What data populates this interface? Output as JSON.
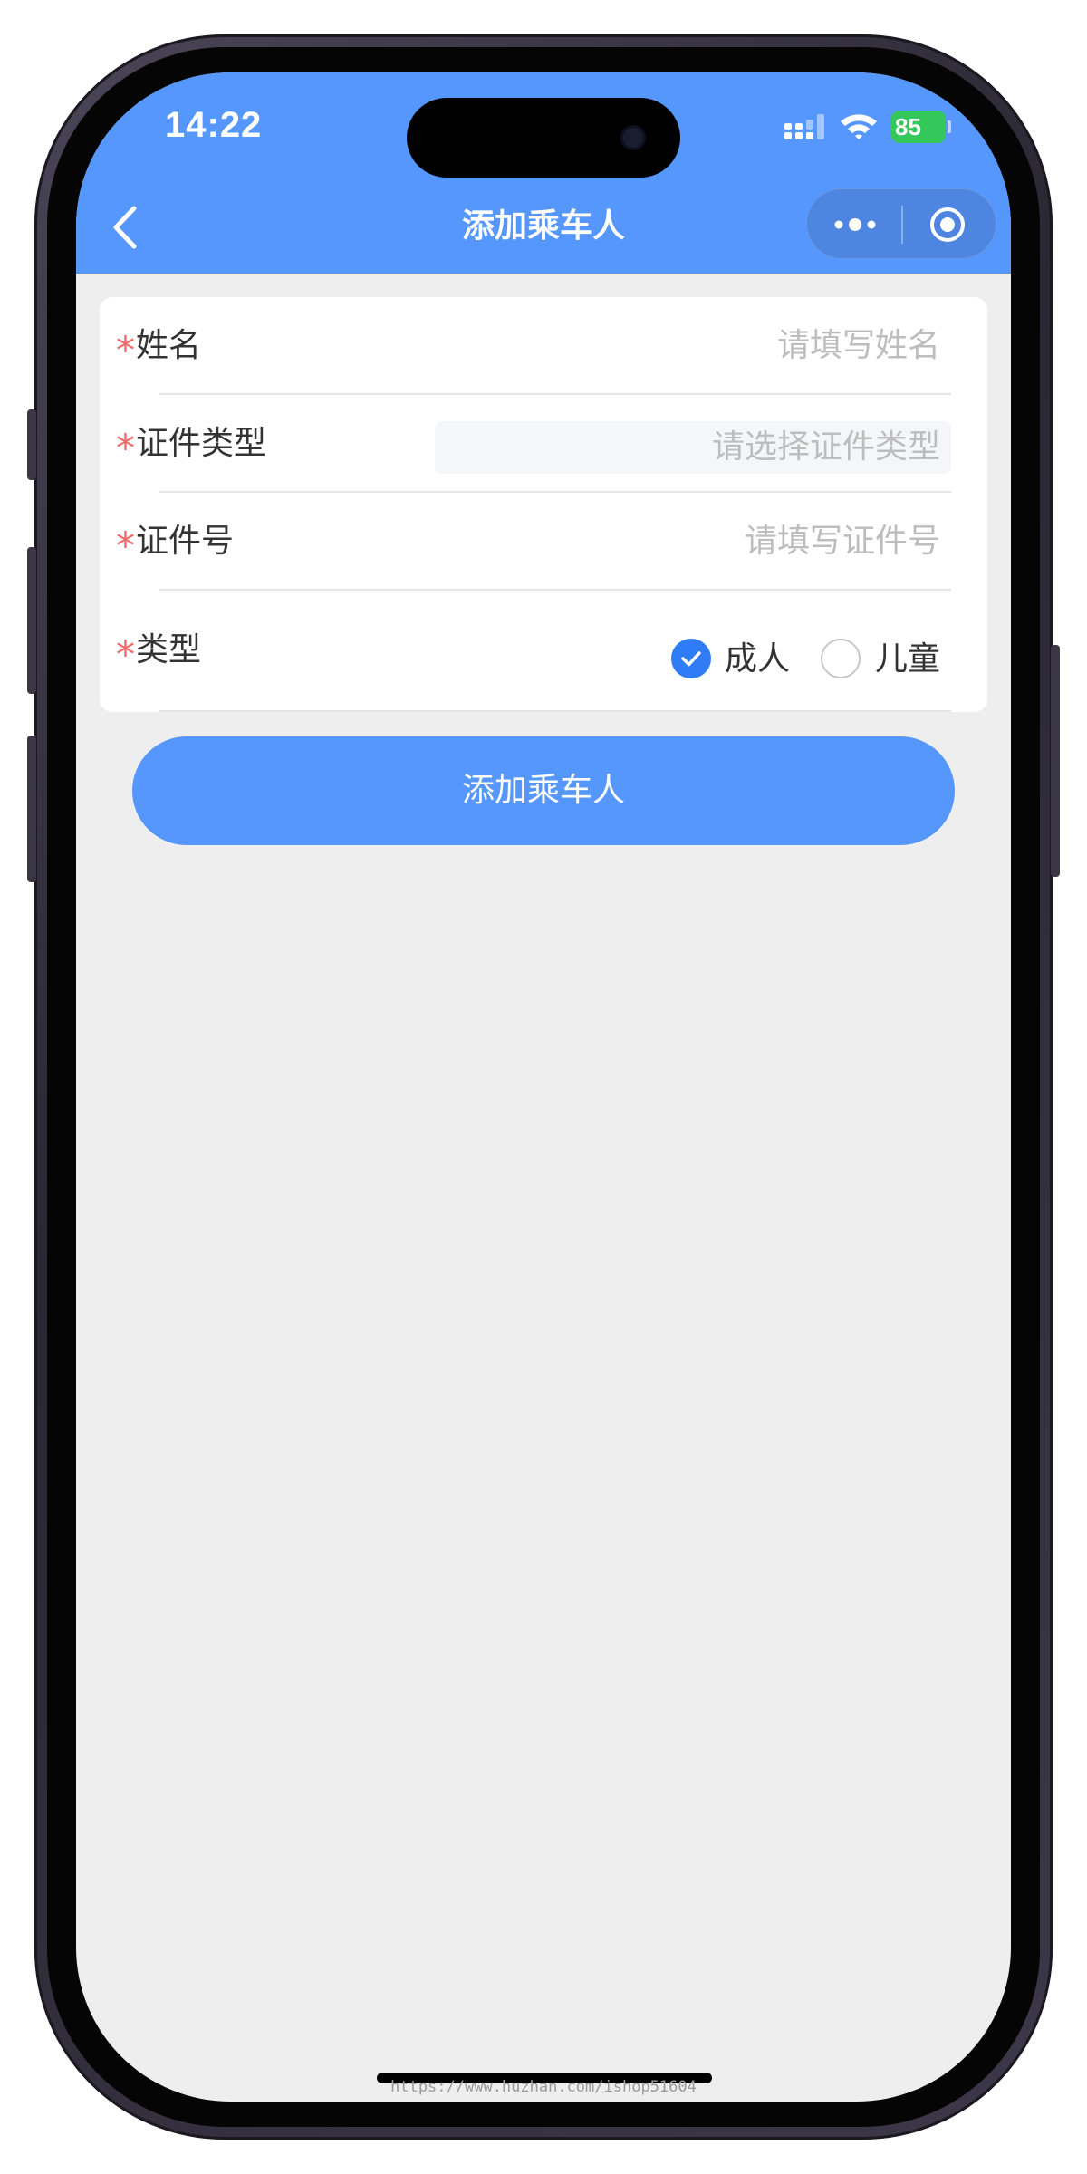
{
  "status_bar": {
    "time": "14:22",
    "battery_level": "85",
    "signal_icon": "cellular-signal-icon",
    "wifi_icon": "wifi-icon",
    "battery_color": "#34c759"
  },
  "nav_bar": {
    "title": "添加乘车人",
    "back_icon": "chevron-left-icon",
    "menu_icon": "more-dots-icon",
    "close_icon": "target-circle-icon",
    "background_color": "#5597fc"
  },
  "form": {
    "required_mark": "*",
    "name_field": {
      "label": "姓名",
      "placeholder": "请填写姓名"
    },
    "id_type_field": {
      "label": "证件类型",
      "placeholder": "请选择证件类型"
    },
    "id_number_field": {
      "label": "证件号",
      "placeholder": "请填写证件号"
    },
    "type_field": {
      "label": "类型",
      "options": [
        {
          "label": "成人",
          "checked": true
        },
        {
          "label": "儿童",
          "checked": false
        }
      ]
    }
  },
  "submit_button": {
    "label": "添加乘车人"
  },
  "watermark": "https://www.huzhan.com/ishop51604",
  "colors": {
    "primary": "#5597fc",
    "radio_checked": "#2f7cf6",
    "required": "#f06a6a",
    "page_background": "#eeeeee"
  }
}
